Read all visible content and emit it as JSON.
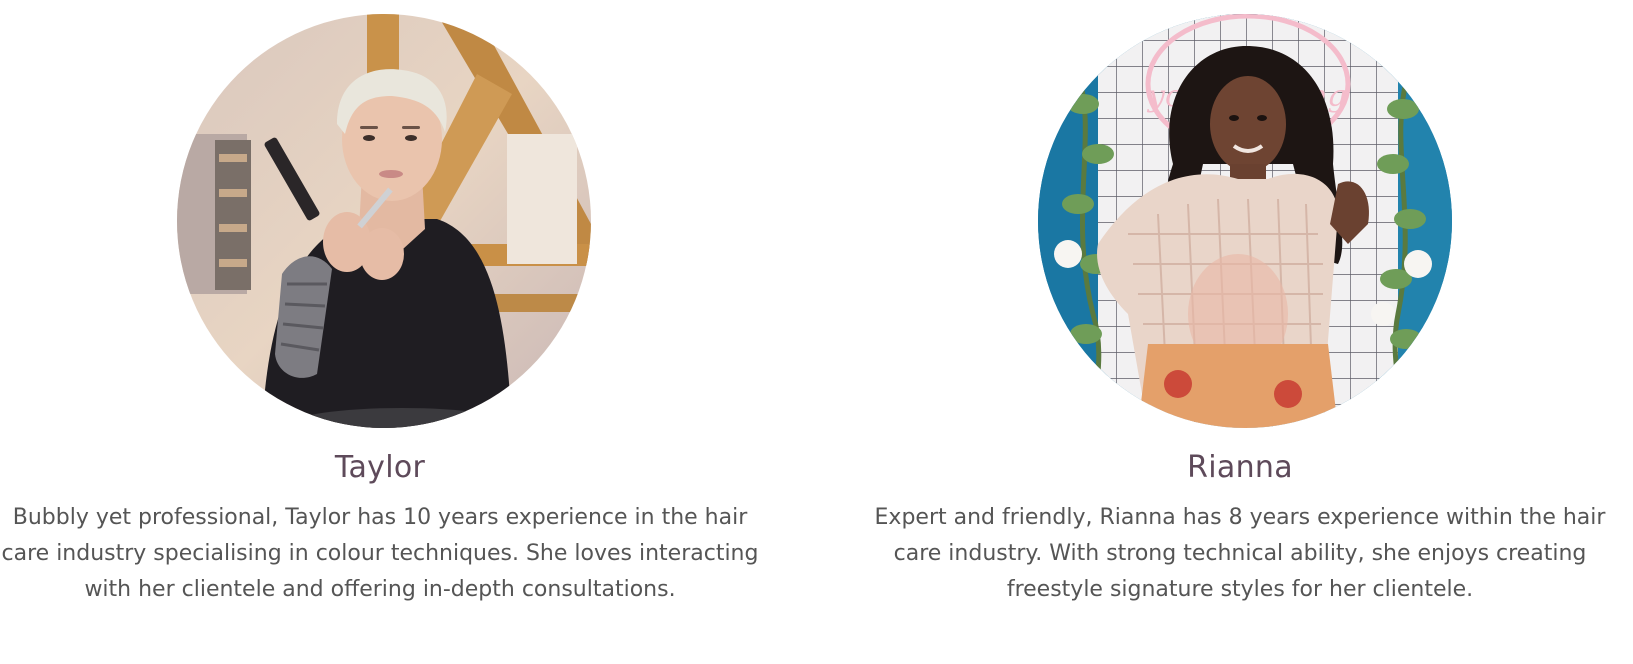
{
  "team": {
    "members": [
      {
        "name": "Taylor",
        "bio": "Bubbly yet professional, Taylor has 10 years experience in the hair care industry specialising in colour techniques. She loves interacting with her clientele and offering in-depth consultations.",
        "photo": {
          "icon": "portrait-photo"
        }
      },
      {
        "name": "Rianna",
        "bio": "Expert and friendly, Rianna has 8 years experience within the hair care industry. With strong technical ability, she enjoys creating freestyle signature styles for her clientele.",
        "photo": {
          "icon": "portrait-photo"
        }
      }
    ]
  }
}
